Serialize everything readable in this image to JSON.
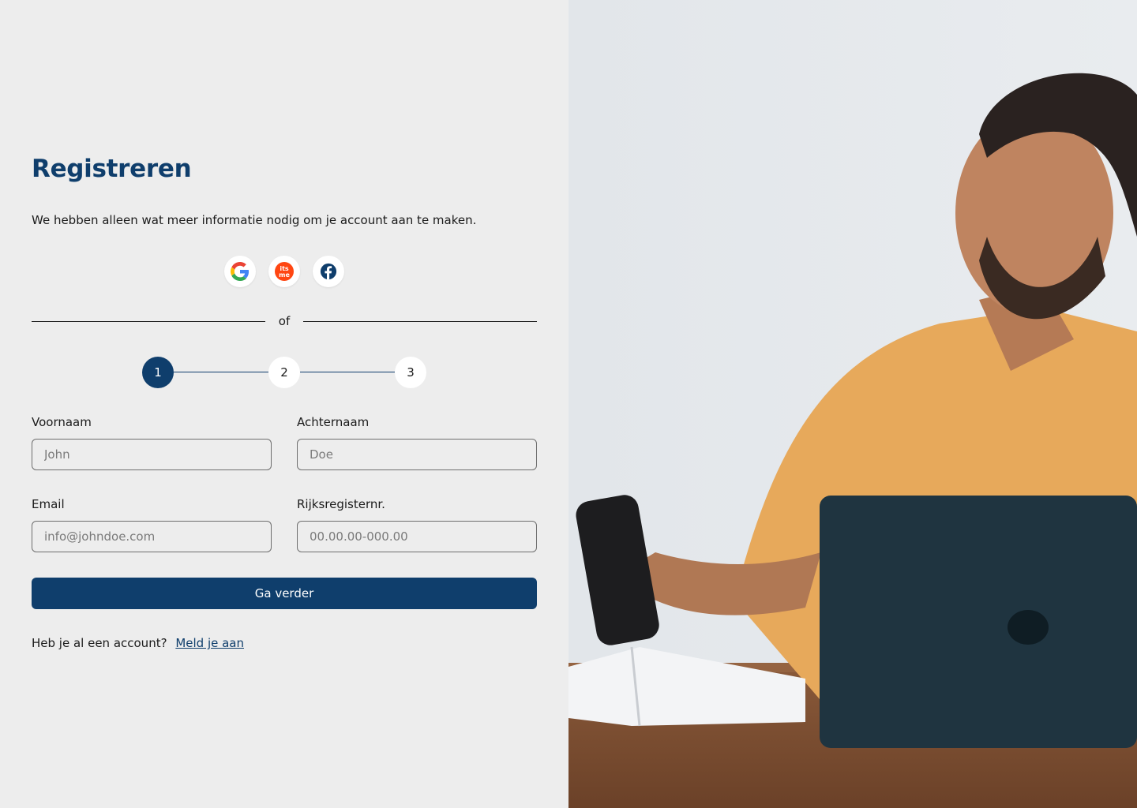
{
  "form": {
    "title": "Registreren",
    "subtitle": "We hebben alleen wat meer informatie nodig om je account aan te maken.",
    "divider_text": "of",
    "steps": [
      "1",
      "2",
      "3"
    ],
    "active_step": 1,
    "first_name": {
      "label": "Voornaam",
      "placeholder": "John",
      "value": ""
    },
    "last_name": {
      "label": "Achternaam",
      "placeholder": "Doe",
      "value": ""
    },
    "email": {
      "label": "Email",
      "placeholder": "info@johndoe.com",
      "value": ""
    },
    "national_id": {
      "label": "Rijksregisternr.",
      "placeholder": "00.00.00-000.00",
      "value": ""
    },
    "submit_label": "Ga verder",
    "login_prompt": "Heb je al een account?",
    "login_link": "Meld je aan"
  },
  "social": [
    {
      "icon": "google-icon"
    },
    {
      "icon": "itsme-icon",
      "text": "its me"
    },
    {
      "icon": "facebook-icon"
    }
  ],
  "colors": {
    "primary": "#0f3e6c",
    "background": "#ededed",
    "itsme_orange": "#ff4612",
    "facebook_blue": "#0f3e6c"
  }
}
